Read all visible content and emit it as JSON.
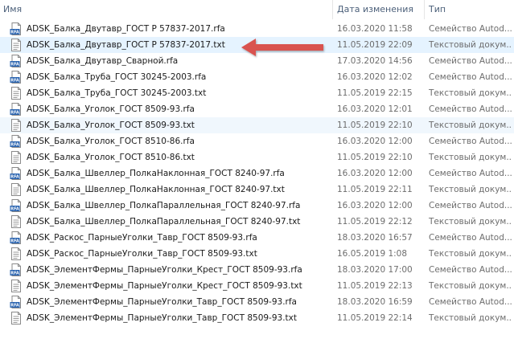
{
  "header": {
    "name": "Имя",
    "date": "Дата изменения",
    "type": "Тип"
  },
  "files": [
    {
      "name": "ADSK_Балка_Двутавр_ГОСТ Р 57837-2017.rfa",
      "date": "16.03.2020 11:58",
      "type": "Семейство Autod...",
      "icon": "rfa-file-icon"
    },
    {
      "name": "ADSK_Балка_Двутавр_ГОСТ Р 57837-2017.txt",
      "date": "11.05.2019 22:09",
      "type": "Текстовый докум...",
      "icon": "txt-file-icon"
    },
    {
      "name": "ADSK_Балка_Двутавр_Сварной.rfa",
      "date": "17.03.2020 14:56",
      "type": "Семейство Autod...",
      "icon": "rfa-file-icon"
    },
    {
      "name": "ADSK_Балка_Труба_ГОСТ 30245-2003.rfa",
      "date": "16.03.2020 12:02",
      "type": "Семейство Autod...",
      "icon": "rfa-file-icon"
    },
    {
      "name": "ADSK_Балка_Труба_ГОСТ 30245-2003.txt",
      "date": "11.05.2019 22:15",
      "type": "Текстовый докум...",
      "icon": "txt-file-icon"
    },
    {
      "name": "ADSK_Балка_Уголок_ГОСТ 8509-93.rfa",
      "date": "16.03.2020 12:01",
      "type": "Семейство Autod...",
      "icon": "rfa-file-icon"
    },
    {
      "name": "ADSK_Балка_Уголок_ГОСТ 8509-93.txt",
      "date": "11.05.2019 22:10",
      "type": "Текстовый докум...",
      "icon": "txt-file-icon"
    },
    {
      "name": "ADSK_Балка_Уголок_ГОСТ 8510-86.rfa",
      "date": "16.03.2020 12:00",
      "type": "Семейство Autod...",
      "icon": "rfa-file-icon"
    },
    {
      "name": "ADSK_Балка_Уголок_ГОСТ 8510-86.txt",
      "date": "11.05.2019 22:10",
      "type": "Текстовый докум...",
      "icon": "txt-file-icon"
    },
    {
      "name": "ADSK_Балка_Швеллер_ПолкаНаклонная_ГОСТ 8240-97.rfa",
      "date": "16.03.2020 12:00",
      "type": "Семейство Autod...",
      "icon": "rfa-file-icon"
    },
    {
      "name": "ADSK_Балка_Швеллер_ПолкаНаклонная_ГОСТ 8240-97.txt",
      "date": "11.05.2019 22:11",
      "type": "Текстовый докум...",
      "icon": "txt-file-icon"
    },
    {
      "name": "ADSK_Балка_Швеллер_ПолкаПараллельная_ГОСТ 8240-97.rfa",
      "date": "16.03.2020 12:00",
      "type": "Семейство Autod...",
      "icon": "rfa-file-icon"
    },
    {
      "name": "ADSK_Балка_Швеллер_ПолкаПараллельная_ГОСТ 8240-97.txt",
      "date": "11.05.2019 22:12",
      "type": "Текстовый докум...",
      "icon": "txt-file-icon"
    },
    {
      "name": "ADSK_Раскос_ПарныеУголки_Тавр_ГОСТ 8509-93.rfa",
      "date": "18.03.2020 16:57",
      "type": "Семейство Autod...",
      "icon": "rfa-file-icon"
    },
    {
      "name": "ADSK_Раскос_ПарныеУголки_Тавр_ГОСТ 8509-93.txt",
      "date": "16.05.2019 1:08",
      "type": "Текстовый докум...",
      "icon": "txt-file-icon"
    },
    {
      "name": "ADSK_ЭлементФермы_ПарныеУголки_Крест_ГОСТ 8509-93.rfa",
      "date": "18.03.2020 17:00",
      "type": "Семейство Autod...",
      "icon": "rfa-file-icon"
    },
    {
      "name": "ADSK_ЭлементФермы_ПарныеУголки_Крест_ГОСТ 8509-93.txt",
      "date": "11.05.2019 22:13",
      "type": "Текстовый докум...",
      "icon": "txt-file-icon"
    },
    {
      "name": "ADSK_ЭлементФермы_ПарныеУголки_Тавр_ГОСТ 8509-93.rfa",
      "date": "18.03.2020 16:59",
      "type": "Семейство Autod...",
      "icon": "rfa-file-icon"
    },
    {
      "name": "ADSK_ЭлементФермы_ПарныеУголки_Тавр_ГОСТ 8509-93.txt",
      "date": "11.05.2019 22:14",
      "type": "Текстовый докум...",
      "icon": "txt-file-icon"
    }
  ],
  "rfa_icon_label": "RFA",
  "colors": {
    "selected_row": "#e5f3ff",
    "highlight_row": "#f0f7fd",
    "arrow": "#d9534f",
    "rfa_icon": "#2a64b0"
  }
}
